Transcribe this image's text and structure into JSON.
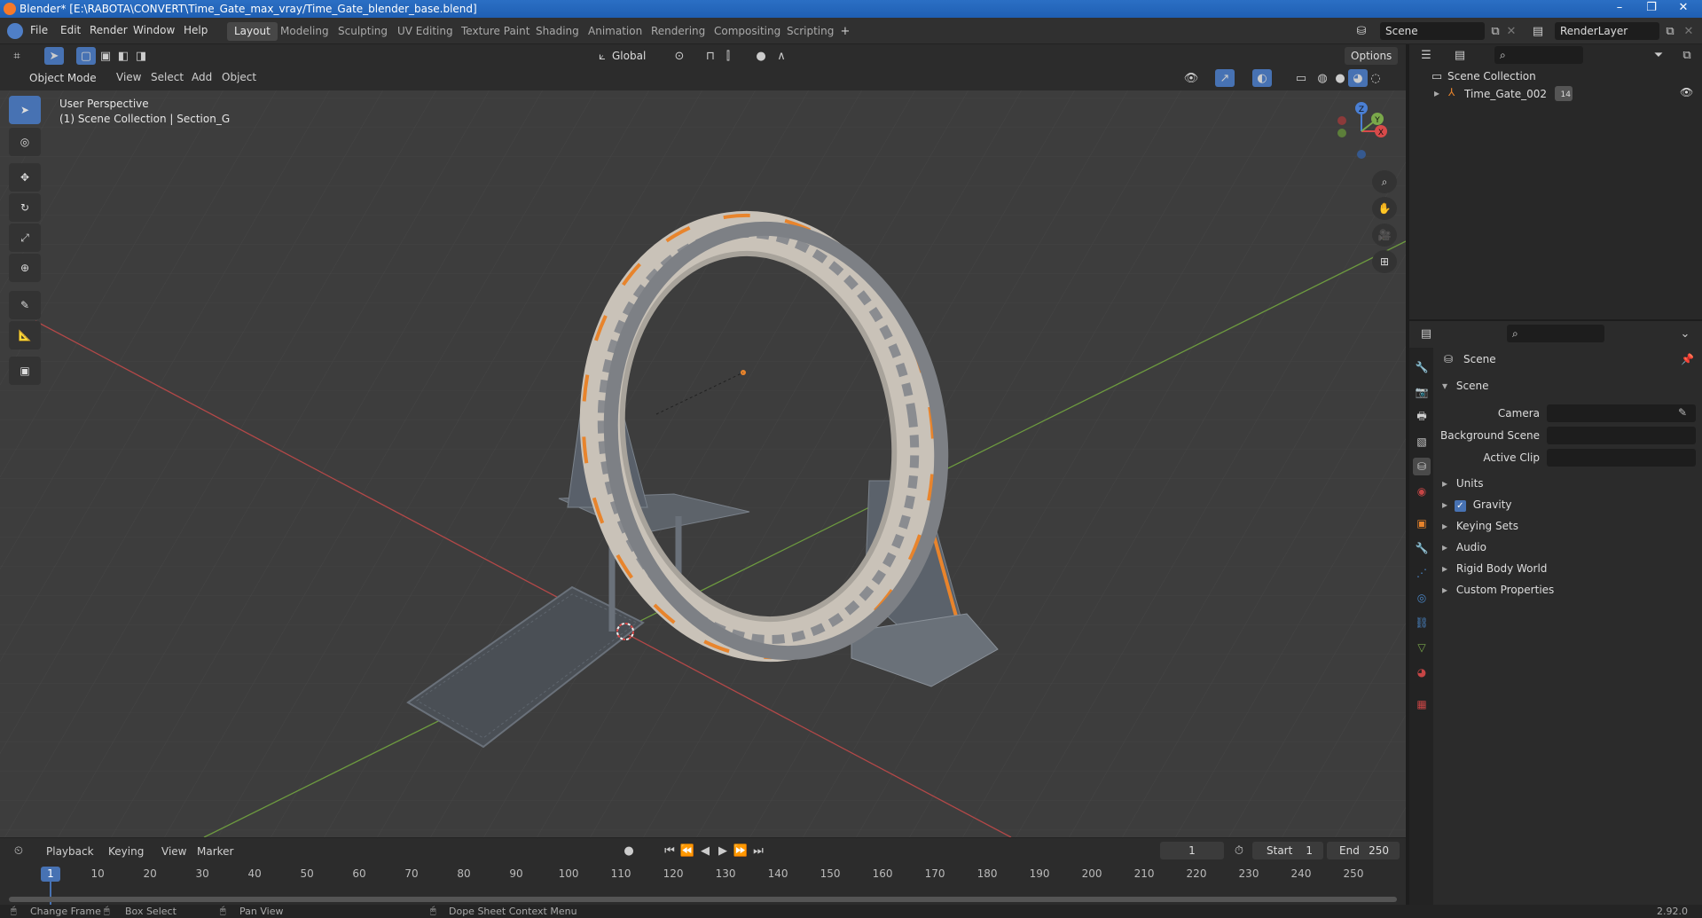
{
  "window": {
    "title": "Blender* [E:\\RABOTA\\CONVERT\\Time_Gate_max_vray/Time_Gate_blender_base.blend]"
  },
  "menu": [
    "File",
    "Edit",
    "Render",
    "Window",
    "Help"
  ],
  "workspaces": [
    "Layout",
    "Modeling",
    "Sculpting",
    "UV Editing",
    "Texture Paint",
    "Shading",
    "Animation",
    "Rendering",
    "Compositing",
    "Scripting"
  ],
  "active_workspace": "Layout",
  "scene_field": "Scene",
  "renderlayer_field": "RenderLayer",
  "viewport_header": {
    "orientation": "Global",
    "options": "Options",
    "mode": "Object Mode",
    "menus": [
      "View",
      "Select",
      "Add",
      "Object"
    ]
  },
  "viewport": {
    "perspective": "User Perspective",
    "collection_info": "(1) Scene Collection | Section_G",
    "gizmo_axes": {
      "x": "X",
      "y": "Y",
      "z": "Z"
    }
  },
  "outliner": {
    "root": "Scene Collection",
    "items": [
      {
        "name": "Time_Gate_002",
        "badge": "14"
      }
    ]
  },
  "properties": {
    "context": "Scene",
    "panel": "Scene",
    "fields": [
      {
        "label": "Camera",
        "value": ""
      },
      {
        "label": "Background Scene",
        "value": ""
      },
      {
        "label": "Active Clip",
        "value": ""
      }
    ],
    "subpanels": [
      "Units",
      "Gravity",
      "Keying Sets",
      "Audio",
      "Rigid Body World",
      "Custom Properties"
    ],
    "gravity_checked": true
  },
  "timeline": {
    "menus": [
      "Playback",
      "Keying",
      "View",
      "Marker"
    ],
    "current_frame": "1",
    "start_label": "Start",
    "start": "1",
    "end_label": "End",
    "end": "250",
    "ticks": [
      "1",
      "10",
      "20",
      "30",
      "40",
      "50",
      "60",
      "70",
      "80",
      "90",
      "100",
      "110",
      "120",
      "130",
      "140",
      "150",
      "160",
      "170",
      "180",
      "190",
      "200",
      "210",
      "220",
      "230",
      "240",
      "250"
    ]
  },
  "statusbar": {
    "items": [
      "Change Frame",
      "Box Select",
      "Pan View",
      "Dope Sheet Context Menu"
    ],
    "version": "2.92.0"
  },
  "colors": {
    "accent": "#4772b3",
    "orange": "#e8842c",
    "x_axis": "#c64545",
    "y_axis": "#7aa84a"
  }
}
